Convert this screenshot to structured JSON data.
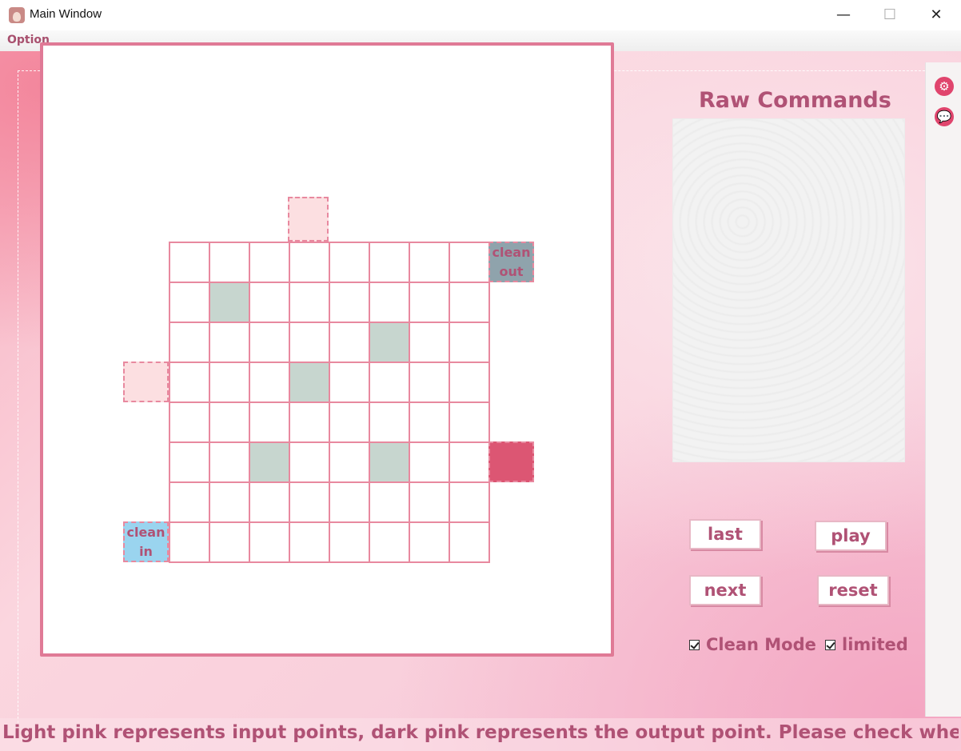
{
  "window": {
    "title": "Main Window",
    "minimize_glyph": "—",
    "maximize_glyph": "☐",
    "close_glyph": "✕"
  },
  "menu": {
    "option_label": "Option"
  },
  "board": {
    "rows": 8,
    "cols": 8,
    "blocked_cells": [
      [
        1,
        1
      ],
      [
        2,
        5
      ],
      [
        3,
        3
      ],
      [
        5,
        2
      ],
      [
        5,
        5
      ]
    ],
    "ports": {
      "input_top_label": "",
      "input_left_label": "",
      "output_right_label": "",
      "clean_out_label_1": "clean",
      "clean_out_label_2": "out",
      "clean_in_label_1": "clean",
      "clean_in_label_2": "in"
    },
    "colors": {
      "grid_line": "#e8899f",
      "blocked": "#c7d6cf",
      "input": "#fcdfe1",
      "output": "#dc5673",
      "clean_out": "#8fa3ac",
      "clean_in": "#9ad4ef"
    }
  },
  "raw_commands": {
    "title": "Raw Commands",
    "content": ""
  },
  "controls": {
    "last_label": "last",
    "play_label": "play",
    "next_label": "next",
    "reset_label": "reset",
    "clean_mode_label": "Clean Mode",
    "clean_mode_checked": true,
    "limited_label": "limited",
    "limited_checked": true
  },
  "side_icons": {
    "gear": "⚙",
    "chat": "💬"
  },
  "status": {
    "message": "Light pink represents input points, dark pink represents the output point. Please check whether y"
  }
}
